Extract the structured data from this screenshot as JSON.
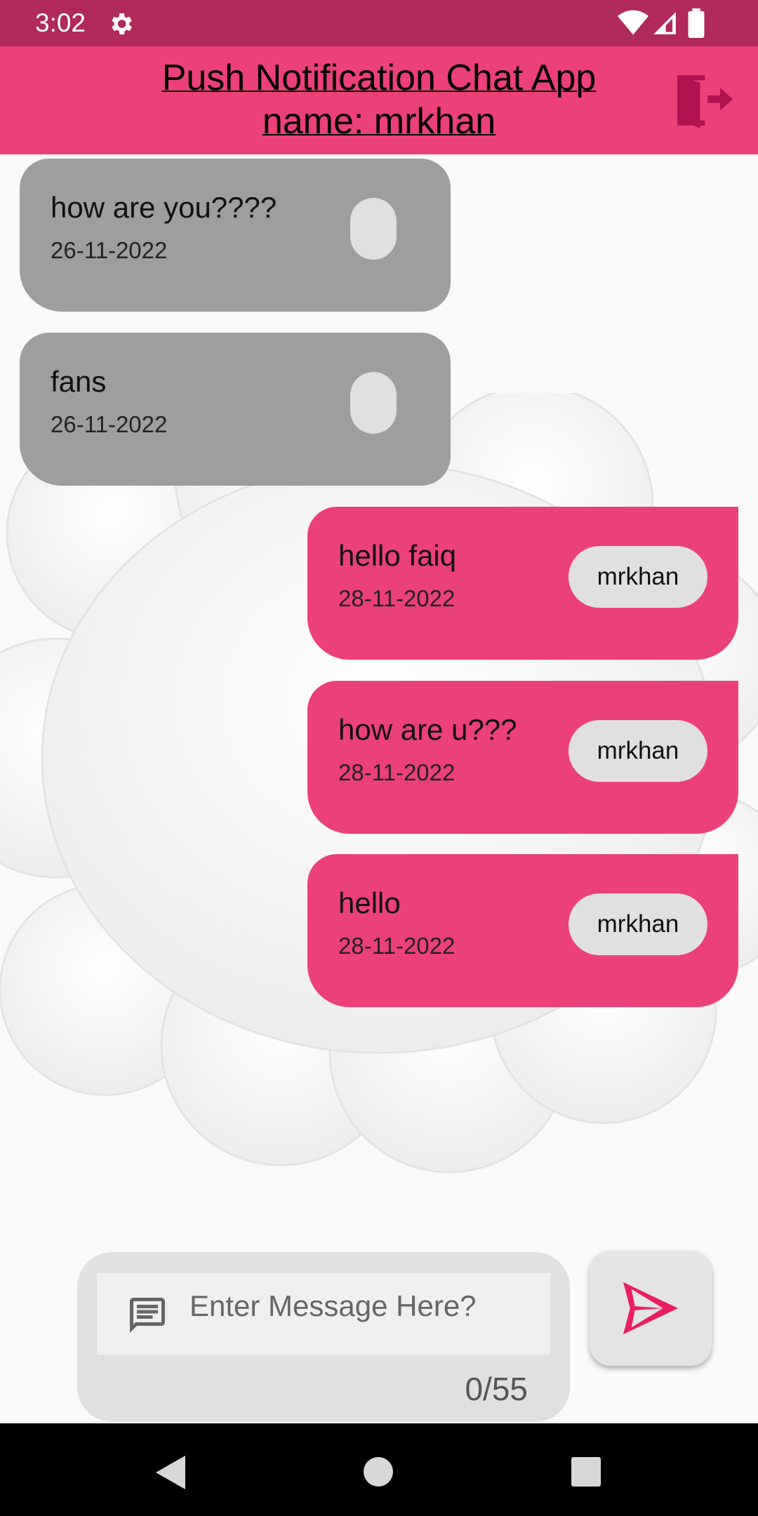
{
  "status_bar": {
    "time": "3:02",
    "icons": [
      "gear-icon",
      "wifi-icon",
      "signal-icon",
      "battery-icon"
    ]
  },
  "app_bar": {
    "title_line1": "Push Notification Chat App",
    "title_line2": "name: mrkhan",
    "logout_icon": "logout-icon",
    "background_color": "#ec407a"
  },
  "messages": [
    {
      "text": "how are you????",
      "date": "26-11-2022",
      "sender": "",
      "side": "left"
    },
    {
      "text": "fans",
      "date": "26-11-2022",
      "sender": "",
      "side": "left"
    },
    {
      "text": "hello faiq",
      "date": "28-11-2022",
      "sender": "mrkhan",
      "side": "right"
    },
    {
      "text": "how are u???",
      "date": "28-11-2022",
      "sender": "mrkhan",
      "side": "right"
    },
    {
      "text": "hello",
      "date": "28-11-2022",
      "sender": "mrkhan",
      "side": "right"
    }
  ],
  "composer": {
    "placeholder": "Enter Message Here?",
    "value": "",
    "counter": "0/55",
    "icon": "message-icon"
  },
  "send_button": {
    "icon": "send-icon",
    "color": "#e91e63"
  },
  "colors": {
    "received_bubble": "#9e9e9e",
    "sent_bubble": "#ec407a",
    "status_bar": "#b02a5b"
  }
}
